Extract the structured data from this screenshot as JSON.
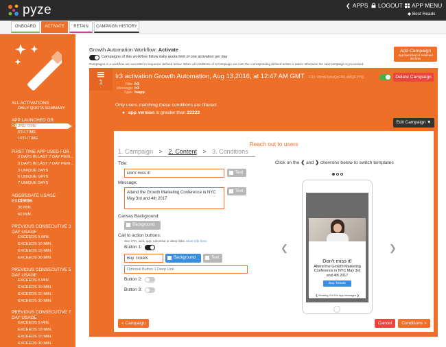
{
  "brand": {
    "name": "pyze"
  },
  "topnav": {
    "apps": "APPS",
    "logout": "LOGOUT",
    "menu": "APP MENU",
    "app_name": "Best Reads"
  },
  "tabs": [
    "ONBOARD",
    "ACTIVATE",
    "RETAIN",
    "CAMPAIGN HISTORY"
  ],
  "sidebar": {
    "sections": [
      {
        "title": "ALL ACTIVATIONS",
        "items": [
          "DAILY QUOTA SUMMARY"
        ]
      },
      {
        "title": "APP LAUNCHED OR RESUMED",
        "items": [
          "3RD TIME",
          "5TH TIME",
          "10TH TIME"
        ],
        "active": "3RD TIME"
      },
      {
        "title": "FIRST TIME APP USED FOR",
        "items": [
          "2 DAYS IN LAST 7 DAY PERI...",
          "3 DAYS IN LAST 7 DAY PERI...",
          "3 UNIQUE DAYS",
          "5 UNIQUE DAYS",
          "7 UNIQUE DAYS"
        ]
      },
      {
        "title": "AGGREGATE USAGE EXCEEDS",
        "items": [
          "15 MIN.",
          "30 MIN.",
          "60 MIN."
        ]
      },
      {
        "title": "PREVIOUS CONSECUTIVE 3 DAY USAGE",
        "items": [
          "EXCEEDS 5 MIN.",
          "EXCEEDS 10 MIN.",
          "EXCEEDS 15 MIN.",
          "EXCEEDS 30 MIN."
        ]
      },
      {
        "title": "PREVIOUS CONSECUTIVE 5 DAY USAGE",
        "items": [
          "EXCEEDS 5 MIN.",
          "EXCEEDS 10 MIN.",
          "EXCEEDS 15 MIN.",
          "EXCEEDS 30 MIN."
        ]
      },
      {
        "title": "PREVIOUS CONSECUTIVE 7 DAY USAGE",
        "items": [
          "EXCEEDS 5 MIN.",
          "EXCEEDS 10 MIN.",
          "EXCEEDS 15 MIN.",
          "EXCEEDS 30 MIN."
        ]
      }
    ]
  },
  "workflow": {
    "title_prefix": "Growth Automation Workflow:",
    "title_value": "Activate",
    "toggle_text": "Campaigns of this workflow follow daily quota limit of one activation per day",
    "note": "Campaigns in a workflow are executed in sequence defined below. When all conditions of a Campaign are met, the corresponding defined action is taken, otherwise the next campaign is processed.",
    "add_label": "Add Campaign",
    "add_sub": "App launched or resumed 3rd time"
  },
  "campaign": {
    "index": "1",
    "title": "Ir3 activation Growth Automation, Aug 13,2016, at 12:47 AM GMT",
    "cid": "- CID: WmtFlufwQcFl0LxMQF3YQ",
    "delete_label": "Delete Campaign",
    "meta": [
      {
        "k": "Title:",
        "v": "Ir3"
      },
      {
        "k": "Message:",
        "v": "Ir3"
      },
      {
        "k": "Type:",
        "v": "Inapp"
      }
    ],
    "filter_text": "Only users matching these conditions are filtered:",
    "condition": {
      "field": "app version",
      "op": "is greater than",
      "value": "22222"
    },
    "edit_label": "Edit Campaign"
  },
  "wizard": {
    "heading": "Reach out to users",
    "steps": [
      "1. Campaign",
      "2. Content",
      "3. Conditions"
    ],
    "seps": [
      ">",
      ">"
    ],
    "title_label": "Title:",
    "title_value": "Don't miss it!",
    "text_label": "Text",
    "message_label": "Message:",
    "message_value": "Attend the Growth Marketing Conference in NYC May 3rd and 4th 2017",
    "canvas_label": "Canvas Background:",
    "background_label": "Background",
    "cta_label": "Call to action buttons:",
    "cta_note": "See CTA, web, app, universal or deep links.",
    "cta_link": "More info here.",
    "b1_label": "Button 1:",
    "b1_value": "Buy Tickets",
    "deeplink_placeholder": "Optional Button 1 Deep Link",
    "b2_label": "Button 2:",
    "b3_label": "Button 3:",
    "back_label": "< Campaign",
    "cancel_label": "Cancel",
    "next_label": "Conditions >"
  },
  "preview": {
    "hint_a": "Click on the",
    "hint_b": "and",
    "hint_c": "chevrons below to switch templates",
    "headline": "Don't miss it!",
    "body": "Attend the Growth Marketing Conference in NYC May 3rd and 4th 2017",
    "cta": "Buy Tickets",
    "footer": "Showing 3 of 5 in-app messages"
  },
  "colors": {
    "accent": "#ee6f28",
    "topbar": "#2a2a2a",
    "delete": "#e8463d",
    "toggle_green": "#4cae4c",
    "blue": "#3b8edf",
    "dark_button": "#333333"
  }
}
